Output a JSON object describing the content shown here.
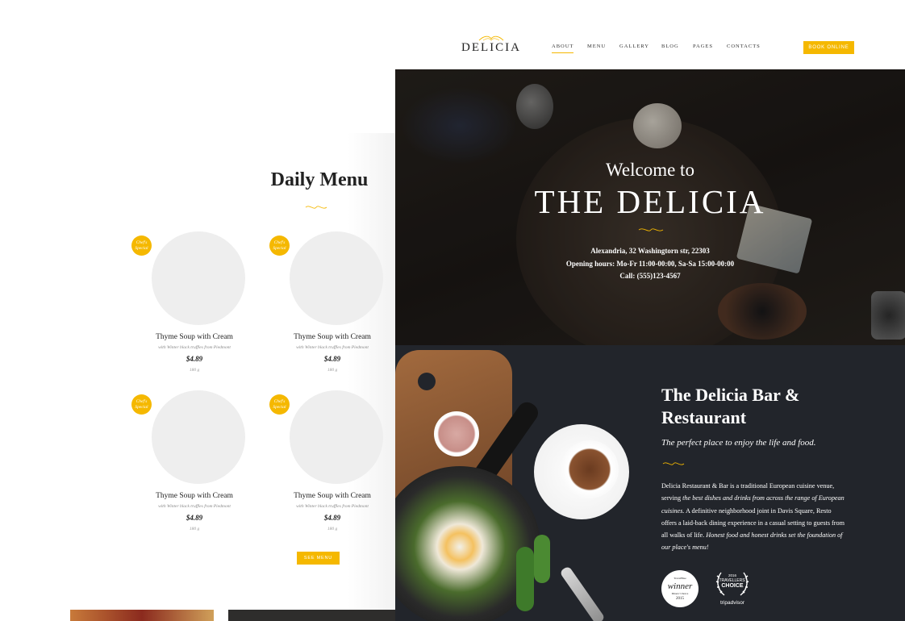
{
  "brand": {
    "name": "DELICIA"
  },
  "nav": {
    "items": [
      "ABOUT",
      "MENU",
      "GALLERY",
      "BLOG",
      "PAGES",
      "CONTACTS"
    ],
    "active": "ABOUT",
    "cta": "BOOK ONLINE"
  },
  "hero": {
    "welcome": "Welcome to",
    "title": "THE DELICIA",
    "address": "Alexandria, 32 Washingtorn str, 22303",
    "hours": "Opening hours:  Mo-Fr 11:00-00:00, Sa-Sa 15:00-00:00",
    "phone": "Call: (555)123-4567"
  },
  "menu": {
    "title": "Daily Menu",
    "dishes": [
      {
        "name": "Thyme Soup with Cream",
        "description": "with Winter black truffles from Piedmont",
        "price": "$4.89",
        "weight": "180 g",
        "badge": "Chef's Special",
        "image": "salad"
      },
      {
        "name": "Thyme Soup with Cream",
        "description": "with Winter black truffles from Piedmont",
        "price": "$4.89",
        "weight": "180 g",
        "badge": "Chef's Special",
        "image": "grilled-meat"
      },
      {
        "name": "Thyme Soup with Cream",
        "description": "with Winter black truffles from Piedmont",
        "price": "$4.89",
        "weight": "180 g",
        "badge": "Chef's Special",
        "image": "pasta"
      },
      {
        "name": "Thyme Soup with Cream",
        "description": "with Winter black truffles from Piedmont",
        "price": "$4.89",
        "weight": "180 g",
        "badge": "Chef's Special",
        "image": "fries-chicken"
      }
    ],
    "button": "SEE MENU"
  },
  "about": {
    "title": "The Delicia Bar & Restaurant",
    "tagline": "The perfect place to enjoy the life and food.",
    "body_parts": {
      "p1": "Delicia Restaurant & Bar is a traditional European cuisine venue, serving ",
      "p2": "the best dishes and drinks from across the range of European cuisines.",
      "p3": " A definitive neighborhood joint in Davis Square, Resto offers a laid-back dining experience in a casual setting to guests from all walks of life. ",
      "p4": "Honest food and honest drinks set the foundation of  our place's menu!"
    },
    "awards": {
      "winner": {
        "line1": "TravelBlue",
        "line2": "winner",
        "line3": "Diners' Choice",
        "line4": "2015"
      },
      "tripadvisor": {
        "year": "2016",
        "line1": "TRAVELLERS'",
        "line2": "CHOICE",
        "line3": "tripadvisor"
      }
    }
  },
  "colors": {
    "accent": "#f5b800",
    "dark": "#22252b",
    "text": "#222222"
  },
  "icons": [
    "logo-swirl-icon",
    "ornament-icon",
    "laurel-wreath-icon"
  ]
}
